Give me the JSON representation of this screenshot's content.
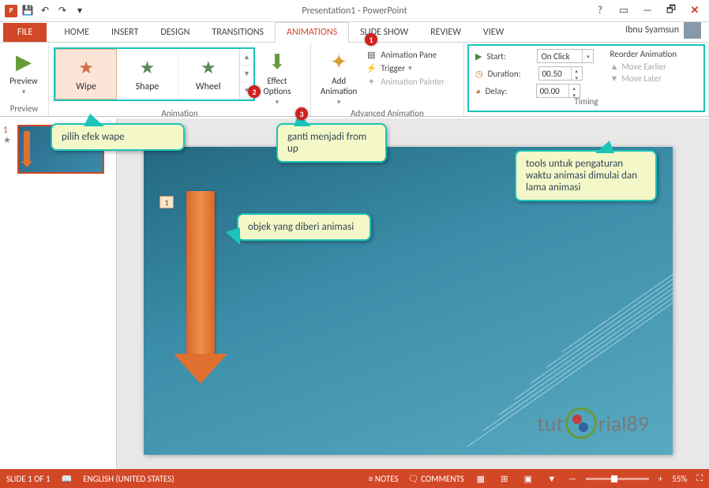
{
  "title": "Presentation1 - PowerPoint",
  "user_name": "Ibnu Syamsun",
  "tabs": {
    "file": "FILE",
    "home": "HOME",
    "insert": "INSERT",
    "design": "DESIGN",
    "transitions": "TRANSITIONS",
    "animations": "ANIMATIONS",
    "slideshow": "SLIDE SHOW",
    "review": "REVIEW",
    "view": "VIEW"
  },
  "ribbon": {
    "preview": {
      "label": "Preview",
      "button": "Preview"
    },
    "animation": {
      "label": "Animation",
      "gallery": {
        "wipe": "Wipe",
        "shape": "Shape",
        "wheel": "Wheel"
      },
      "effect_options": "Effect\nOptions"
    },
    "advanced": {
      "label": "Advanced Animation",
      "add": "Add\nAnimation",
      "pane": "Animation Pane",
      "trigger": "Trigger",
      "painter": "Animation Painter"
    },
    "timing": {
      "label": "Timing",
      "start_label": "Start:",
      "start_value": "On Click",
      "duration_label": "Duration:",
      "duration_value": "00.50",
      "delay_label": "Delay:",
      "delay_value": "00.00",
      "reorder": "Reorder Animation",
      "earlier": "Move Earlier",
      "later": "Move Later"
    }
  },
  "annotations": {
    "callout1": "pilih efek wape",
    "callout2": "ganti menjadi from up",
    "callout3": "objek yang diberi animasi",
    "callout4": "tools untuk pengaturan waktu animasi dimulai dan lama animasi"
  },
  "badges": {
    "b1": "1",
    "b2": "2",
    "b3": "3"
  },
  "slide": {
    "thumb_number": "1",
    "anim_tag": "1"
  },
  "watermark": {
    "pre": "tut",
    "post": "rial89"
  },
  "status": {
    "slide": "SLIDE 1 OF 1",
    "lang": "ENGLISH (UNITED STATES)",
    "notes": "NOTES",
    "comments": "COMMENTS",
    "zoom": "55%"
  }
}
